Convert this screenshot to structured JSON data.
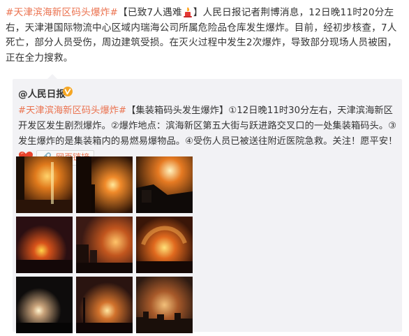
{
  "post": {
    "topic": "#天津滨海新区码头爆炸#",
    "headline": "【已致7人遇难",
    "headline_end": "】",
    "body": "人民日报记者荆博消息，12日晚11时20分左右，天津港国际物流中心区域内瑞海公司所属危险品仓库发生爆炸。目前，经初步核查，7人死亡，部分人员受伤，周边建筑受损。在灭火过程中发生2次爆炸，导致部分现场人员被困，正在全力搜救。"
  },
  "repost": {
    "author": "@人民日报",
    "topic": "#天津滨海新区码头爆炸#",
    "body": "【集装箱码头发生爆炸】①12日晚11时30分左右，天津滨海新区开发区发生剧烈爆炸。②爆炸地点：滨海新区第五大街与跃进路交叉口的一处集装箱码头。③发生爆炸的是集装箱内的易燃易爆物品。④受伤人员已被送往附近医院急救。关注！愿平安！",
    "link_label": "网页链接",
    "link_icon": "link-icon",
    "images": [
      "explosion-photo-1",
      "explosion-photo-2",
      "explosion-photo-3",
      "explosion-photo-4",
      "explosion-photo-5",
      "explosion-photo-6",
      "explosion-photo-7",
      "explosion-photo-8",
      "explosion-photo-9"
    ]
  },
  "colors": {
    "topic": "#eb7350",
    "text": "#333333",
    "repost_bg": "#f2f2f5",
    "verified": "#f5a623"
  }
}
